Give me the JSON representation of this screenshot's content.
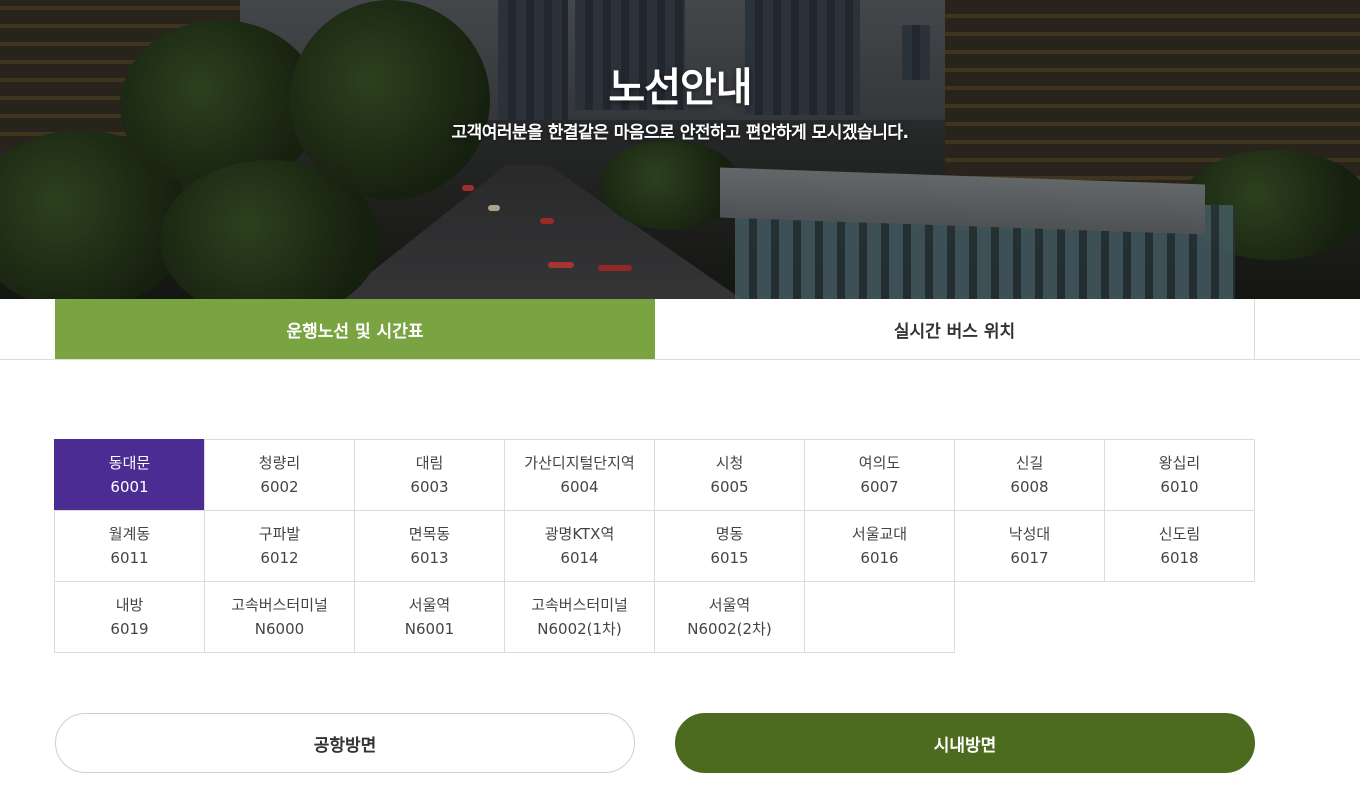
{
  "hero": {
    "title": "노선안내",
    "subtitle": "고객여러분을 한결같은 마음으로 안전하고 편안하게 모시겠습니다."
  },
  "tabs": [
    {
      "label": "운행노선 및 시간표",
      "active": true
    },
    {
      "label": "실시간 버스 위치",
      "active": false
    }
  ],
  "routes": [
    {
      "name": "동대문",
      "number": "6001",
      "selected": true
    },
    {
      "name": "청량리",
      "number": "6002"
    },
    {
      "name": "대림",
      "number": "6003"
    },
    {
      "name": "가산디지털단지역",
      "number": "6004"
    },
    {
      "name": "시청",
      "number": "6005"
    },
    {
      "name": "여의도",
      "number": "6007"
    },
    {
      "name": "신길",
      "number": "6008"
    },
    {
      "name": "왕십리",
      "number": "6010"
    },
    {
      "name": "월계동",
      "number": "6011"
    },
    {
      "name": "구파발",
      "number": "6012"
    },
    {
      "name": "면목동",
      "number": "6013"
    },
    {
      "name": "광명KTX역",
      "number": "6014"
    },
    {
      "name": "명동",
      "number": "6015"
    },
    {
      "name": "서울교대",
      "number": "6016"
    },
    {
      "name": "낙성대",
      "number": "6017"
    },
    {
      "name": "신도림",
      "number": "6018"
    },
    {
      "name": "내방",
      "number": "6019"
    },
    {
      "name": "고속버스터미널",
      "number": "N6000"
    },
    {
      "name": "서울역",
      "number": "N6001"
    },
    {
      "name": "고속버스터미널",
      "number": "N6002(1차)"
    },
    {
      "name": "서울역",
      "number": "N6002(2차)"
    }
  ],
  "directions": {
    "airport_label": "공항방면",
    "city_label": "시내방면",
    "selected": "city"
  },
  "colors": {
    "tab_active": "#7aa342",
    "route_selected": "#4b2c92",
    "city_button": "#4d6b1f"
  }
}
